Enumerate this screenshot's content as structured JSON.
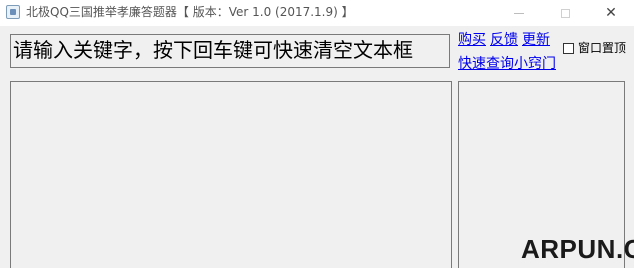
{
  "window": {
    "title": "北极QQ三国推举孝廉答题器【 版本：Ver 1.0 (2017.1.9) 】",
    "minimize_glyph": "—",
    "close_glyph": "✕",
    "icons": [
      "app-icon",
      "minimize-icon",
      "maximize-icon",
      "close-icon"
    ]
  },
  "search": {
    "value": "请输入关键字，按下回车键可快速清空文本框"
  },
  "links": {
    "buy": "购买",
    "feedback": "反馈",
    "update": "更新",
    "query": "快速查询小窍门"
  },
  "options": {
    "pin_window_label": "窗口置顶",
    "pin_window_checked": false
  },
  "watermark": {
    "text": "ARPUN.COM"
  }
}
